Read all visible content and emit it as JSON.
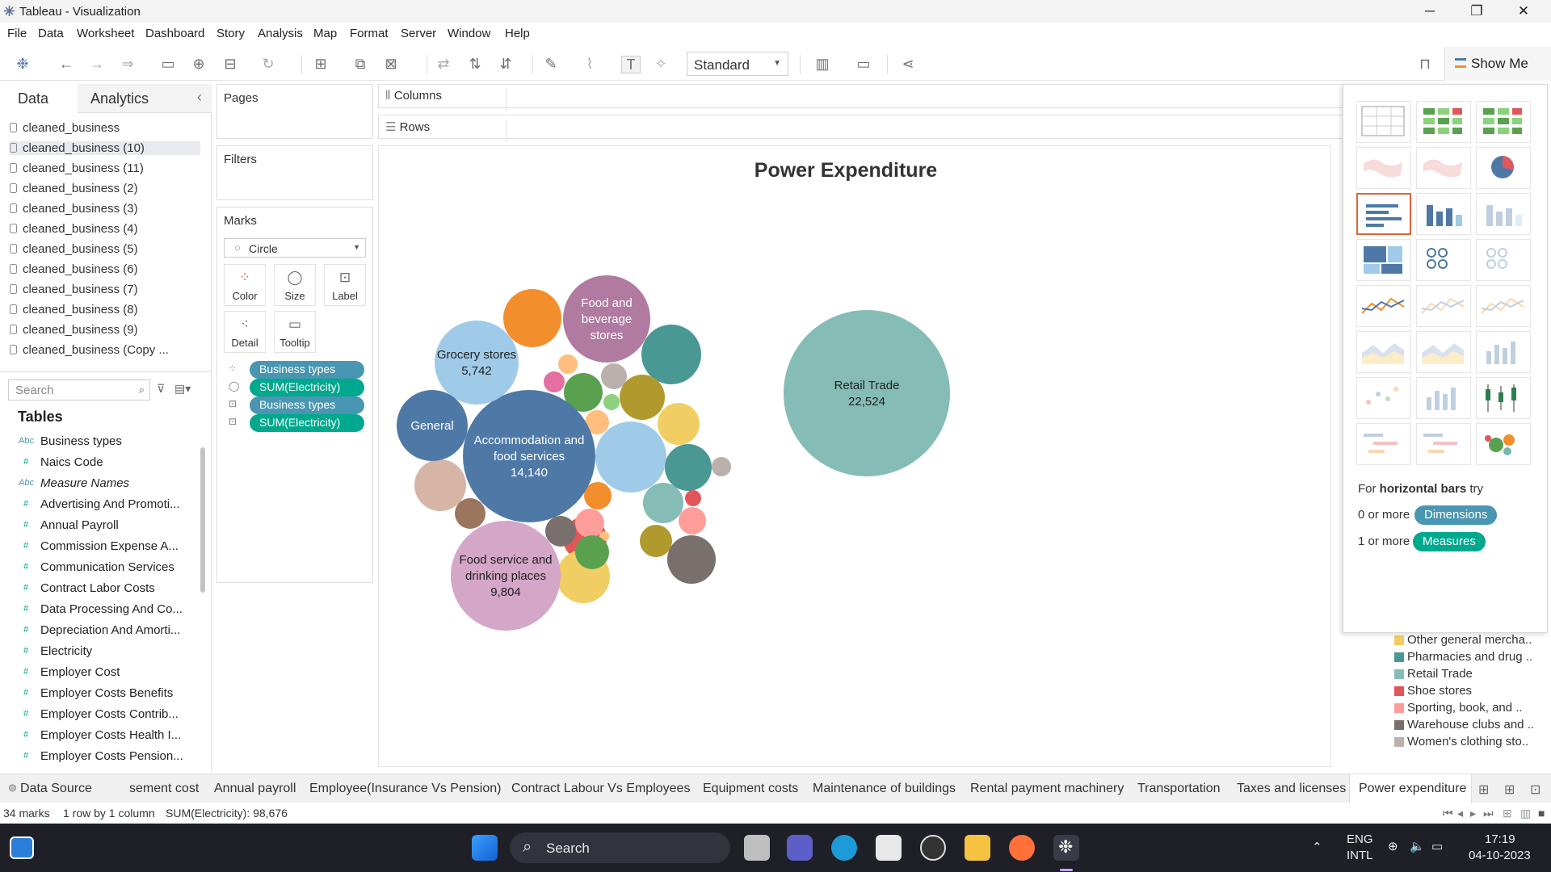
{
  "window": {
    "title": "Tableau - Visualization",
    "min": "─",
    "restore": "❐",
    "close": "✕"
  },
  "menu": [
    "File",
    "Data",
    "Worksheet",
    "Dashboard",
    "Story",
    "Analysis",
    "Map",
    "Format",
    "Server",
    "Window",
    "Help"
  ],
  "toolbar": {
    "fit": "Standard",
    "show_me": "Show Me"
  },
  "left": {
    "tab_data": "Data",
    "tab_analytics": "Analytics",
    "collapse": "‹",
    "datasources": [
      "cleaned_business",
      "cleaned_business (10)",
      "cleaned_business (11)",
      "cleaned_business (2)",
      "cleaned_business (3)",
      "cleaned_business (4)",
      "cleaned_business (5)",
      "cleaned_business (6)",
      "cleaned_business (7)",
      "cleaned_business (8)",
      "cleaned_business (9)",
      "cleaned_business (Copy ..."
    ],
    "search_placeholder": "Search",
    "tables_header": "Tables",
    "fields": [
      {
        "type": "Abc",
        "name": "Business types"
      },
      {
        "type": "#",
        "name": "Naics Code"
      },
      {
        "type": "Abc",
        "name": "Measure Names"
      },
      {
        "type": "#",
        "name": "Advertising And Promoti..."
      },
      {
        "type": "#",
        "name": "Annual Payroll"
      },
      {
        "type": "#",
        "name": "Commission Expense A..."
      },
      {
        "type": "#",
        "name": "Communication Services"
      },
      {
        "type": "#",
        "name": "Contract Labor Costs"
      },
      {
        "type": "#",
        "name": "Data Processing And Co..."
      },
      {
        "type": "#",
        "name": "Depreciation And Amorti..."
      },
      {
        "type": "#",
        "name": "Electricity"
      },
      {
        "type": "#",
        "name": "Employer Cost"
      },
      {
        "type": "#",
        "name": "Employer Costs Benefits"
      },
      {
        "type": "#",
        "name": "Employer Costs Contrib..."
      },
      {
        "type": "#",
        "name": "Employer Costs Health I..."
      },
      {
        "type": "#",
        "name": "Employer Costs Pension..."
      }
    ]
  },
  "cards": {
    "pages": "Pages",
    "filters": "Filters",
    "marks": "Marks",
    "mark_type": "Circle",
    "buttons": [
      "Color",
      "Size",
      "Label",
      "Detail",
      "Tooltip"
    ],
    "pills": [
      "Business types",
      "SUM(Electricity)",
      "Business types",
      "SUM(Electricity)"
    ]
  },
  "shelves": {
    "columns": "Columns",
    "rows": "Rows"
  },
  "chart_data": {
    "type": "bubble",
    "title": "Power Expenditure",
    "measure": "SUM(Electricity)",
    "total": 98676,
    "labeled": [
      {
        "name": "Retail Trade",
        "value": 22524,
        "color": "#86bcb6"
      },
      {
        "name": "Accommodation and food services",
        "value": 14140,
        "color": "#4e79a7"
      },
      {
        "name": "Food service and drinking places",
        "value": 9804,
        "color": "#d4a6c8"
      },
      {
        "name": "Grocery stores",
        "value": 5742,
        "color": "#a0cbe8"
      },
      {
        "name": "Food and beverage stores",
        "value": null,
        "color": "#b07aa1"
      },
      {
        "name": "General",
        "value": null,
        "color": "#4e79a7"
      }
    ],
    "label_lines": {
      "Retail Trade": [
        "Retail Trade",
        "22,524"
      ],
      "Accommodation and food services": [
        "Accommodation and",
        "food services",
        "14,140"
      ],
      "Food service and drinking places": [
        "Food service and",
        "drinking places",
        "9,804"
      ],
      "Grocery stores": [
        "Grocery stores",
        "5,742"
      ],
      "Food and beverage stores": [
        "Food and",
        "beverage",
        "stores"
      ],
      "General": [
        "General"
      ]
    },
    "unlabeled_count": 28
  },
  "showme": {
    "hint_prefix": "For ",
    "hint_bold": "horizontal bars",
    "hint_suffix": " try",
    "dims_prefix": "0 or more",
    "dims": "Dimensions",
    "meas_prefix": "1 or more",
    "meas": "Measures"
  },
  "legend": [
    {
      "label": "Other general mercha..",
      "color": "#f1ce63"
    },
    {
      "label": "Pharmacies and drug ..",
      "color": "#499894"
    },
    {
      "label": "Retail Trade",
      "color": "#86bcb6"
    },
    {
      "label": "Shoe stores",
      "color": "#e15759"
    },
    {
      "label": "Sporting, book, and ..",
      "color": "#ff9d9a"
    },
    {
      "label": "Warehouse clubs and ..",
      "color": "#79706e"
    },
    {
      "label": "Women's clothing sto..",
      "color": "#bab0ac"
    }
  ],
  "sheets": [
    "Data Source",
    "sement cost",
    "Annual payroll",
    "Employee(Insurance  Vs Pension)",
    "Contract Labour Vs Employees",
    "Equipment costs",
    "Maintenance of buildings",
    "Rental payment machinery",
    "Transportation",
    "Taxes and licenses",
    "Power expenditure"
  ],
  "status": {
    "marks": "34 marks",
    "rows": "1 row by 1 column",
    "sum": "SUM(Electricity): 98,676"
  },
  "taskbar": {
    "search": "Search",
    "lang1": "ENG",
    "lang2": "INTL",
    "time": "17:19",
    "date": "04-10-2023"
  }
}
